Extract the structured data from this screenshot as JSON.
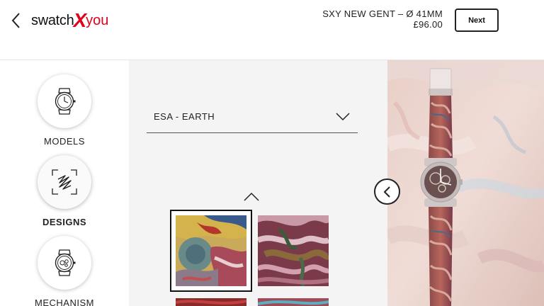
{
  "header": {
    "back_icon": "chevron-left-icon",
    "logo": {
      "part1": "swatch",
      "part2": "X",
      "part3": "you"
    },
    "product_name": "SXY NEW GENT – Ø 41MM",
    "price": "£96.00",
    "next_label": "Next"
  },
  "sidebar": {
    "items": [
      {
        "label": "MODELS",
        "icon": "watch-icon",
        "active": false
      },
      {
        "label": "DESIGNS",
        "icon": "design-pattern-icon",
        "active": true
      },
      {
        "label": "MECHANISM",
        "icon": "watch-mechanism-icon",
        "active": false
      }
    ]
  },
  "panel": {
    "collection_select": {
      "value": "ESA - EARTH",
      "icon": "chevron-down-icon"
    },
    "scroll_up_icon": "chevron-up-icon",
    "thumbnails": [
      {
        "name": "earth-design-1",
        "selected": true
      },
      {
        "name": "earth-design-2",
        "selected": false
      },
      {
        "name": "earth-design-3",
        "selected": false
      },
      {
        "name": "earth-design-4",
        "selected": false
      }
    ]
  },
  "preview": {
    "prev_icon": "chevron-left-circle-icon"
  },
  "colors": {
    "brand_red": "#e2001a",
    "panel_bg": "#f4f4f4",
    "text": "#222222"
  }
}
